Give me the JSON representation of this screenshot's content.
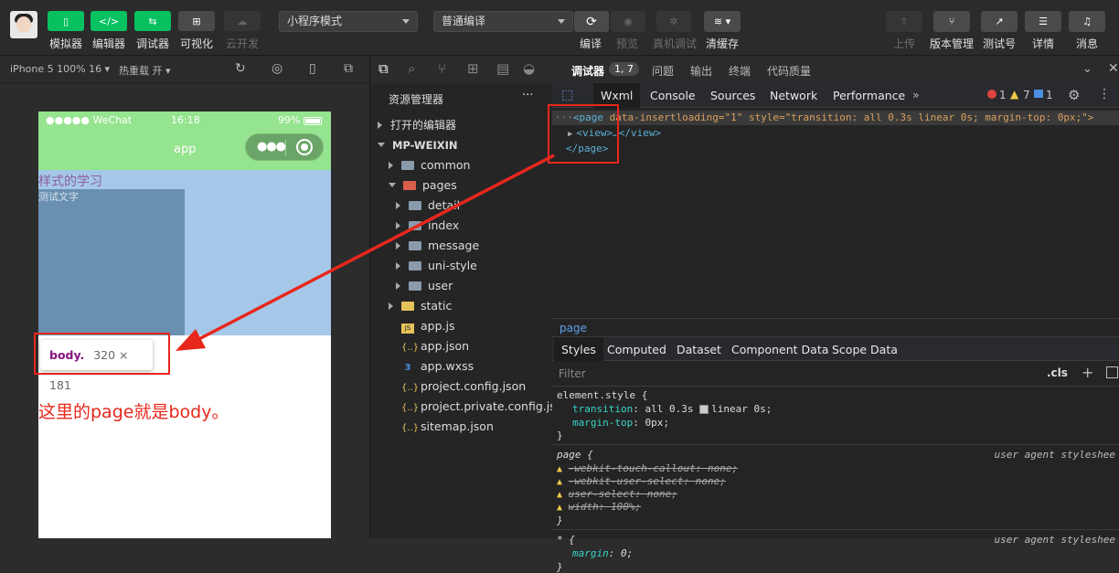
{
  "toolbar": {
    "simulator": "模拟器",
    "editor": "编辑器",
    "debugger": "调试器",
    "visual": "可视化",
    "cloud": "云开发",
    "mode_select": "小程序模式",
    "compile_select": "普通编译",
    "compile": "编译",
    "preview": "预览",
    "remote_debug": "真机调试",
    "clear_cache": "清缓存",
    "upload": "上传",
    "version": "版本管理",
    "test_account": "测试号",
    "details": "详情",
    "messages": "消息"
  },
  "subbar": {
    "device": "iPhone 5 100% 16 ▾",
    "hot_reload": "热重载 开 ▾"
  },
  "phone": {
    "carrier": "●●●●● WeChat",
    "time": "16:18",
    "battery": "99%",
    "nav_title": "app",
    "heading": "样式的学习",
    "small_text": "测试文字"
  },
  "tooltip": {
    "tag": "body.",
    "size": "320 × 181"
  },
  "annotation": "这里的page就是body。",
  "explorer": {
    "title": "资源管理器",
    "open_editors": "打开的编辑器",
    "project": "MP-WEIXIN",
    "items": [
      {
        "name": "common",
        "kind": "folder",
        "depth": 1,
        "expanded": false
      },
      {
        "name": "pages",
        "kind": "folder-red",
        "depth": 1,
        "expanded": true
      },
      {
        "name": "detail",
        "kind": "folder",
        "depth": 2,
        "expanded": false
      },
      {
        "name": "index",
        "kind": "folder",
        "depth": 2,
        "expanded": false
      },
      {
        "name": "message",
        "kind": "folder",
        "depth": 2,
        "expanded": false
      },
      {
        "name": "uni-style",
        "kind": "folder",
        "depth": 2,
        "expanded": false
      },
      {
        "name": "user",
        "kind": "folder",
        "depth": 2,
        "expanded": false
      },
      {
        "name": "static",
        "kind": "folder-yellow",
        "depth": 1,
        "expanded": false
      },
      {
        "name": "app.js",
        "kind": "js",
        "depth": 1
      },
      {
        "name": "app.json",
        "kind": "json",
        "depth": 1
      },
      {
        "name": "app.wxss",
        "kind": "css",
        "depth": 1
      },
      {
        "name": "project.config.json",
        "kind": "json",
        "depth": 1
      },
      {
        "name": "project.private.config.js...",
        "kind": "json",
        "depth": 1
      },
      {
        "name": "sitemap.json",
        "kind": "json",
        "depth": 1
      }
    ]
  },
  "devtools": {
    "top_tabs": [
      "调试器",
      "问题",
      "输出",
      "终端",
      "代码质量"
    ],
    "badge": "1, 7",
    "tabs": [
      "Wxml",
      "Console",
      "Sources",
      "Network",
      "Performance"
    ],
    "errors": "1",
    "warnings": "7",
    "infos": "1",
    "code_line1_tag": "<page",
    "code_line1_attrs": " data-insertloading=\"1\" style=\"transition: all 0.3s linear 0s; margin-top: 0px;\">",
    "code_line2": "<view>…</view>",
    "code_line3": "</page>",
    "breadcrumb": "page",
    "style_tabs": [
      "Styles",
      "Computed",
      "Dataset",
      "Component Data",
      "Scope Data"
    ],
    "filter_placeholder": "Filter",
    "cls": ".cls",
    "rule1_selector": "element.style {",
    "rule1_p1_name": "transition",
    "rule1_p1_val": ": all 0.3s ",
    "rule1_p1_val2": "linear 0s;",
    "rule1_p2_name": "margin-top",
    "rule1_p2_val": ": 0px;",
    "rule2_selector": "page {",
    "rule2_source": "user agent styleshee",
    "rule2_props": [
      "-webkit-touch-callout: none;",
      "-webkit-user-select: none;",
      "user-select: none;",
      "width: 100%;"
    ],
    "rule3_selector": "* {",
    "rule3_source": "user agent styleshee",
    "rule3_p_name": "margin",
    "rule3_p_val": ": 0;",
    "close_brace": "}"
  },
  "colors": {
    "accent_green": "#07c160",
    "nav_green": "#95e48f",
    "annotation_red": "#e8271c"
  }
}
